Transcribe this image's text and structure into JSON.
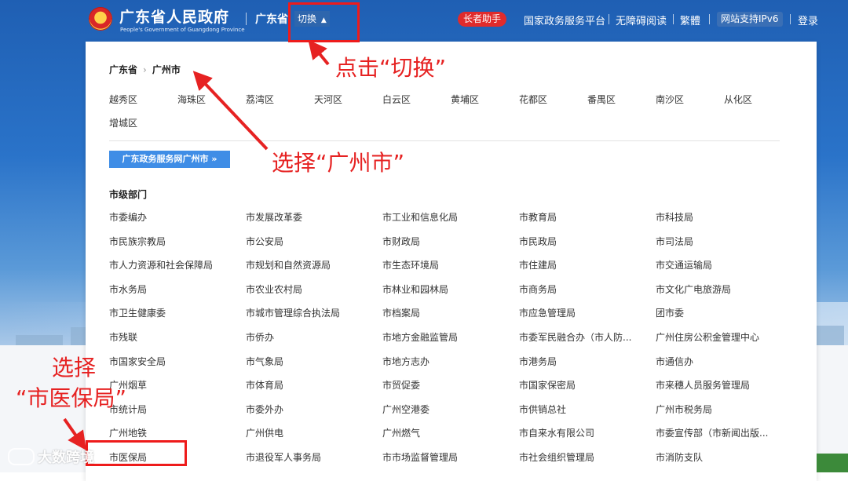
{
  "header": {
    "title": "广东省人民政府",
    "subtitle": "People's Government of Guangdong Province",
    "province": "广东省",
    "switch_label": "切换",
    "elder_mode": "长者助手",
    "links": [
      "国家政务服务平台",
      "无障碍阅读",
      "繁體"
    ],
    "ipv6": "网站支持IPv6",
    "login": "登录"
  },
  "panel": {
    "breadcrumb": [
      "广东省",
      "广州市"
    ],
    "districts": [
      "越秀区",
      "海珠区",
      "荔湾区",
      "天河区",
      "白云区",
      "黄埔区",
      "花都区",
      "番禺区",
      "南沙区",
      "从化区",
      "增城区"
    ],
    "gz_button": "广东政务服务网广州市 »",
    "section_title": "市级部门",
    "departments": [
      [
        "市委编办",
        "市发展改革委",
        "市工业和信息化局",
        "市教育局",
        "市科技局"
      ],
      [
        "市民族宗教局",
        "市公安局",
        "市财政局",
        "市民政局",
        "市司法局"
      ],
      [
        "市人力资源和社会保障局",
        "市规划和自然资源局",
        "市生态环境局",
        "市住建局",
        "市交通运输局"
      ],
      [
        "市水务局",
        "市农业农村局",
        "市林业和园林局",
        "市商务局",
        "市文化广电旅游局"
      ],
      [
        "市卫生健康委",
        "市城市管理综合执法局",
        "市档案局",
        "市应急管理局",
        "团市委"
      ],
      [
        "市残联",
        "市侨办",
        "市地方金融监管局",
        "市委军民融合办（市人防...",
        "广州住房公积金管理中心"
      ],
      [
        "市国家安全局",
        "市气象局",
        "市地方志办",
        "市港务局",
        "市通信办"
      ],
      [
        "广州烟草",
        "市体育局",
        "市贸促委",
        "市国家保密局",
        "市来穗人员服务管理局"
      ],
      [
        "市统计局",
        "市委外办",
        "广州空港委",
        "市供销总社",
        "广州市税务局"
      ],
      [
        "广州地铁",
        "广州供电",
        "广州燃气",
        "市自来水有限公司",
        "市委宣传部（市新闻出版..."
      ],
      [
        "市医保局",
        "市退役军人事务局",
        "市市场监督管理局",
        "市社会组织管理局",
        "市消防支队"
      ]
    ]
  },
  "annotations": {
    "click_switch": "点击“切换”",
    "select_city": "选择“广州市”",
    "select_insurance_1": "选择",
    "select_insurance_2": "“市医保局”"
  },
  "watermark": "大数跨境",
  "colors": {
    "hero_blue": "#2a73c9",
    "accent_red": "#e62222",
    "button_blue": "#3f8de6"
  }
}
